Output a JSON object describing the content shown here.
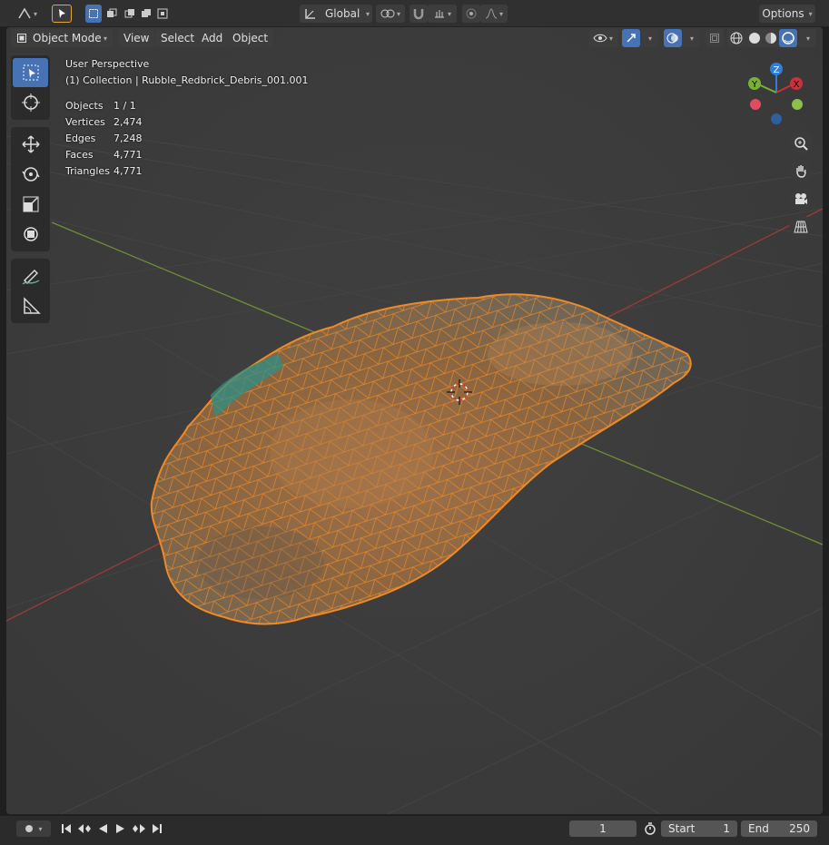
{
  "topbar": {
    "transform_orientation": "Global",
    "options_label": "Options"
  },
  "header": {
    "mode": "Object Mode",
    "menus": [
      "View",
      "Select",
      "Add",
      "Object"
    ]
  },
  "viewport": {
    "perspective_label": "User Perspective",
    "collection_label": "(1) Collection | Rubble_Redbrick_Debris_001.001",
    "stats": [
      {
        "key": "Objects",
        "value": "1 / 1"
      },
      {
        "key": "Vertices",
        "value": "2,474"
      },
      {
        "key": "Edges",
        "value": "7,248"
      },
      {
        "key": "Faces",
        "value": "4,771"
      },
      {
        "key": "Triangles",
        "value": "4,771"
      }
    ],
    "gizmo": {
      "x": "X",
      "y": "Y",
      "z": "Z"
    }
  },
  "timeline": {
    "current_frame": "1",
    "start_label": "Start",
    "start_value": "1",
    "end_label": "End",
    "end_value": "250"
  },
  "colors": {
    "selection_orange": "#f08a24",
    "active_blue": "#4772b3",
    "axis_x": "#c8323c",
    "axis_y": "#7bb030",
    "axis_z": "#2f7fd8"
  }
}
